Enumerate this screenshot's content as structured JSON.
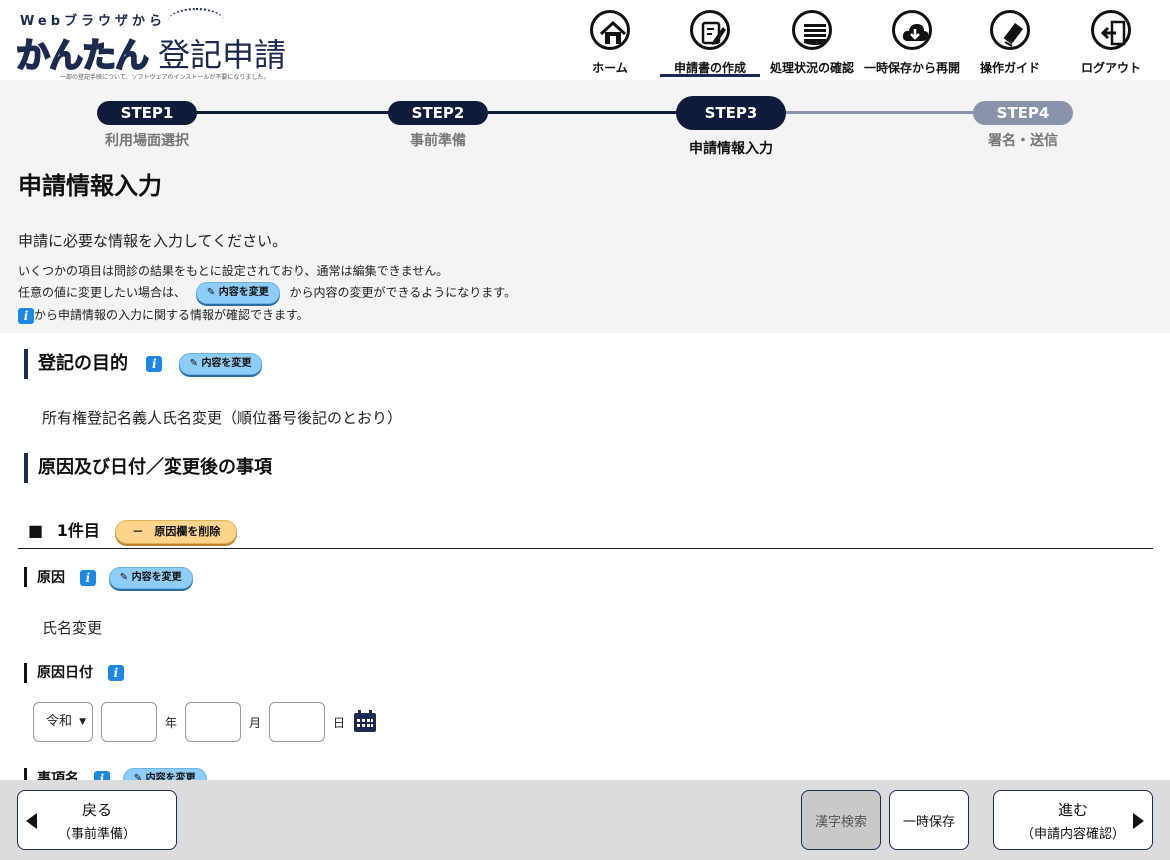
{
  "logo": {
    "sub": "Webブラウザから",
    "kantan": "かんたん",
    "title": "登記申請",
    "note": "一部の登記手続について、ソフトウェアのインストールが不要になりました。"
  },
  "nav": [
    {
      "label": "ホーム",
      "icon": "home-icon"
    },
    {
      "label": "申請書の作成",
      "icon": "edit-document-icon",
      "active": true
    },
    {
      "label": "処理状況の確認",
      "icon": "status-list-icon"
    },
    {
      "label": "一時保存から再開",
      "icon": "cloud-download-icon"
    },
    {
      "label": "操作ガイド",
      "icon": "guide-book-icon"
    },
    {
      "label": "ログアウト",
      "icon": "logout-icon"
    }
  ],
  "steps": [
    {
      "pill": "STEP1",
      "caption": "利用場面選択"
    },
    {
      "pill": "STEP2",
      "caption": "事前準備"
    },
    {
      "pill": "STEP3",
      "caption": "申請情報入力"
    },
    {
      "pill": "STEP4",
      "caption": "署名・送信"
    }
  ],
  "page": {
    "title": "申請情報入力",
    "intro": "申請に必要な情報を入力してください。",
    "note1": "いくつかの項目は問診の結果をもとに設定されており、通常は編集できません。",
    "note2_pre": "任意の値に変更したい場合は、",
    "note2_post": "から内容の変更ができるようになります。",
    "note3": "から申請情報の入力に関する情報が確認できます。",
    "info_glyph": "i",
    "change_label": "内容を変更"
  },
  "sections": {
    "purpose_title": "登記の目的",
    "purpose_value": "所有権登記名義人氏名変更（順位番号後記のとおり）",
    "cause_title": "原因及び日付／変更後の事項",
    "item_label": "1件目",
    "delete_label": "－　原因欄を削除",
    "cause_label": "原因",
    "cause_value": "氏名変更",
    "date_label": "原因日付",
    "era_value": "令和",
    "unit_year": "年",
    "unit_month": "月",
    "unit_day": "日",
    "matter_label": "事項名"
  },
  "footer": {
    "back_l1": "戻る",
    "back_l2": "（事前準備）",
    "kanji": "漢字検索",
    "save": "一時保存",
    "next_l1": "進む",
    "next_l2": "（申請内容確認）"
  },
  "colors": {
    "navy": "#1b2a4e",
    "step_done": "#0f1b3a",
    "step_future": "#8a93aa",
    "change_button": "#8ecdf7",
    "delete_button": "#fcd48c",
    "info": "#1e88e5"
  }
}
